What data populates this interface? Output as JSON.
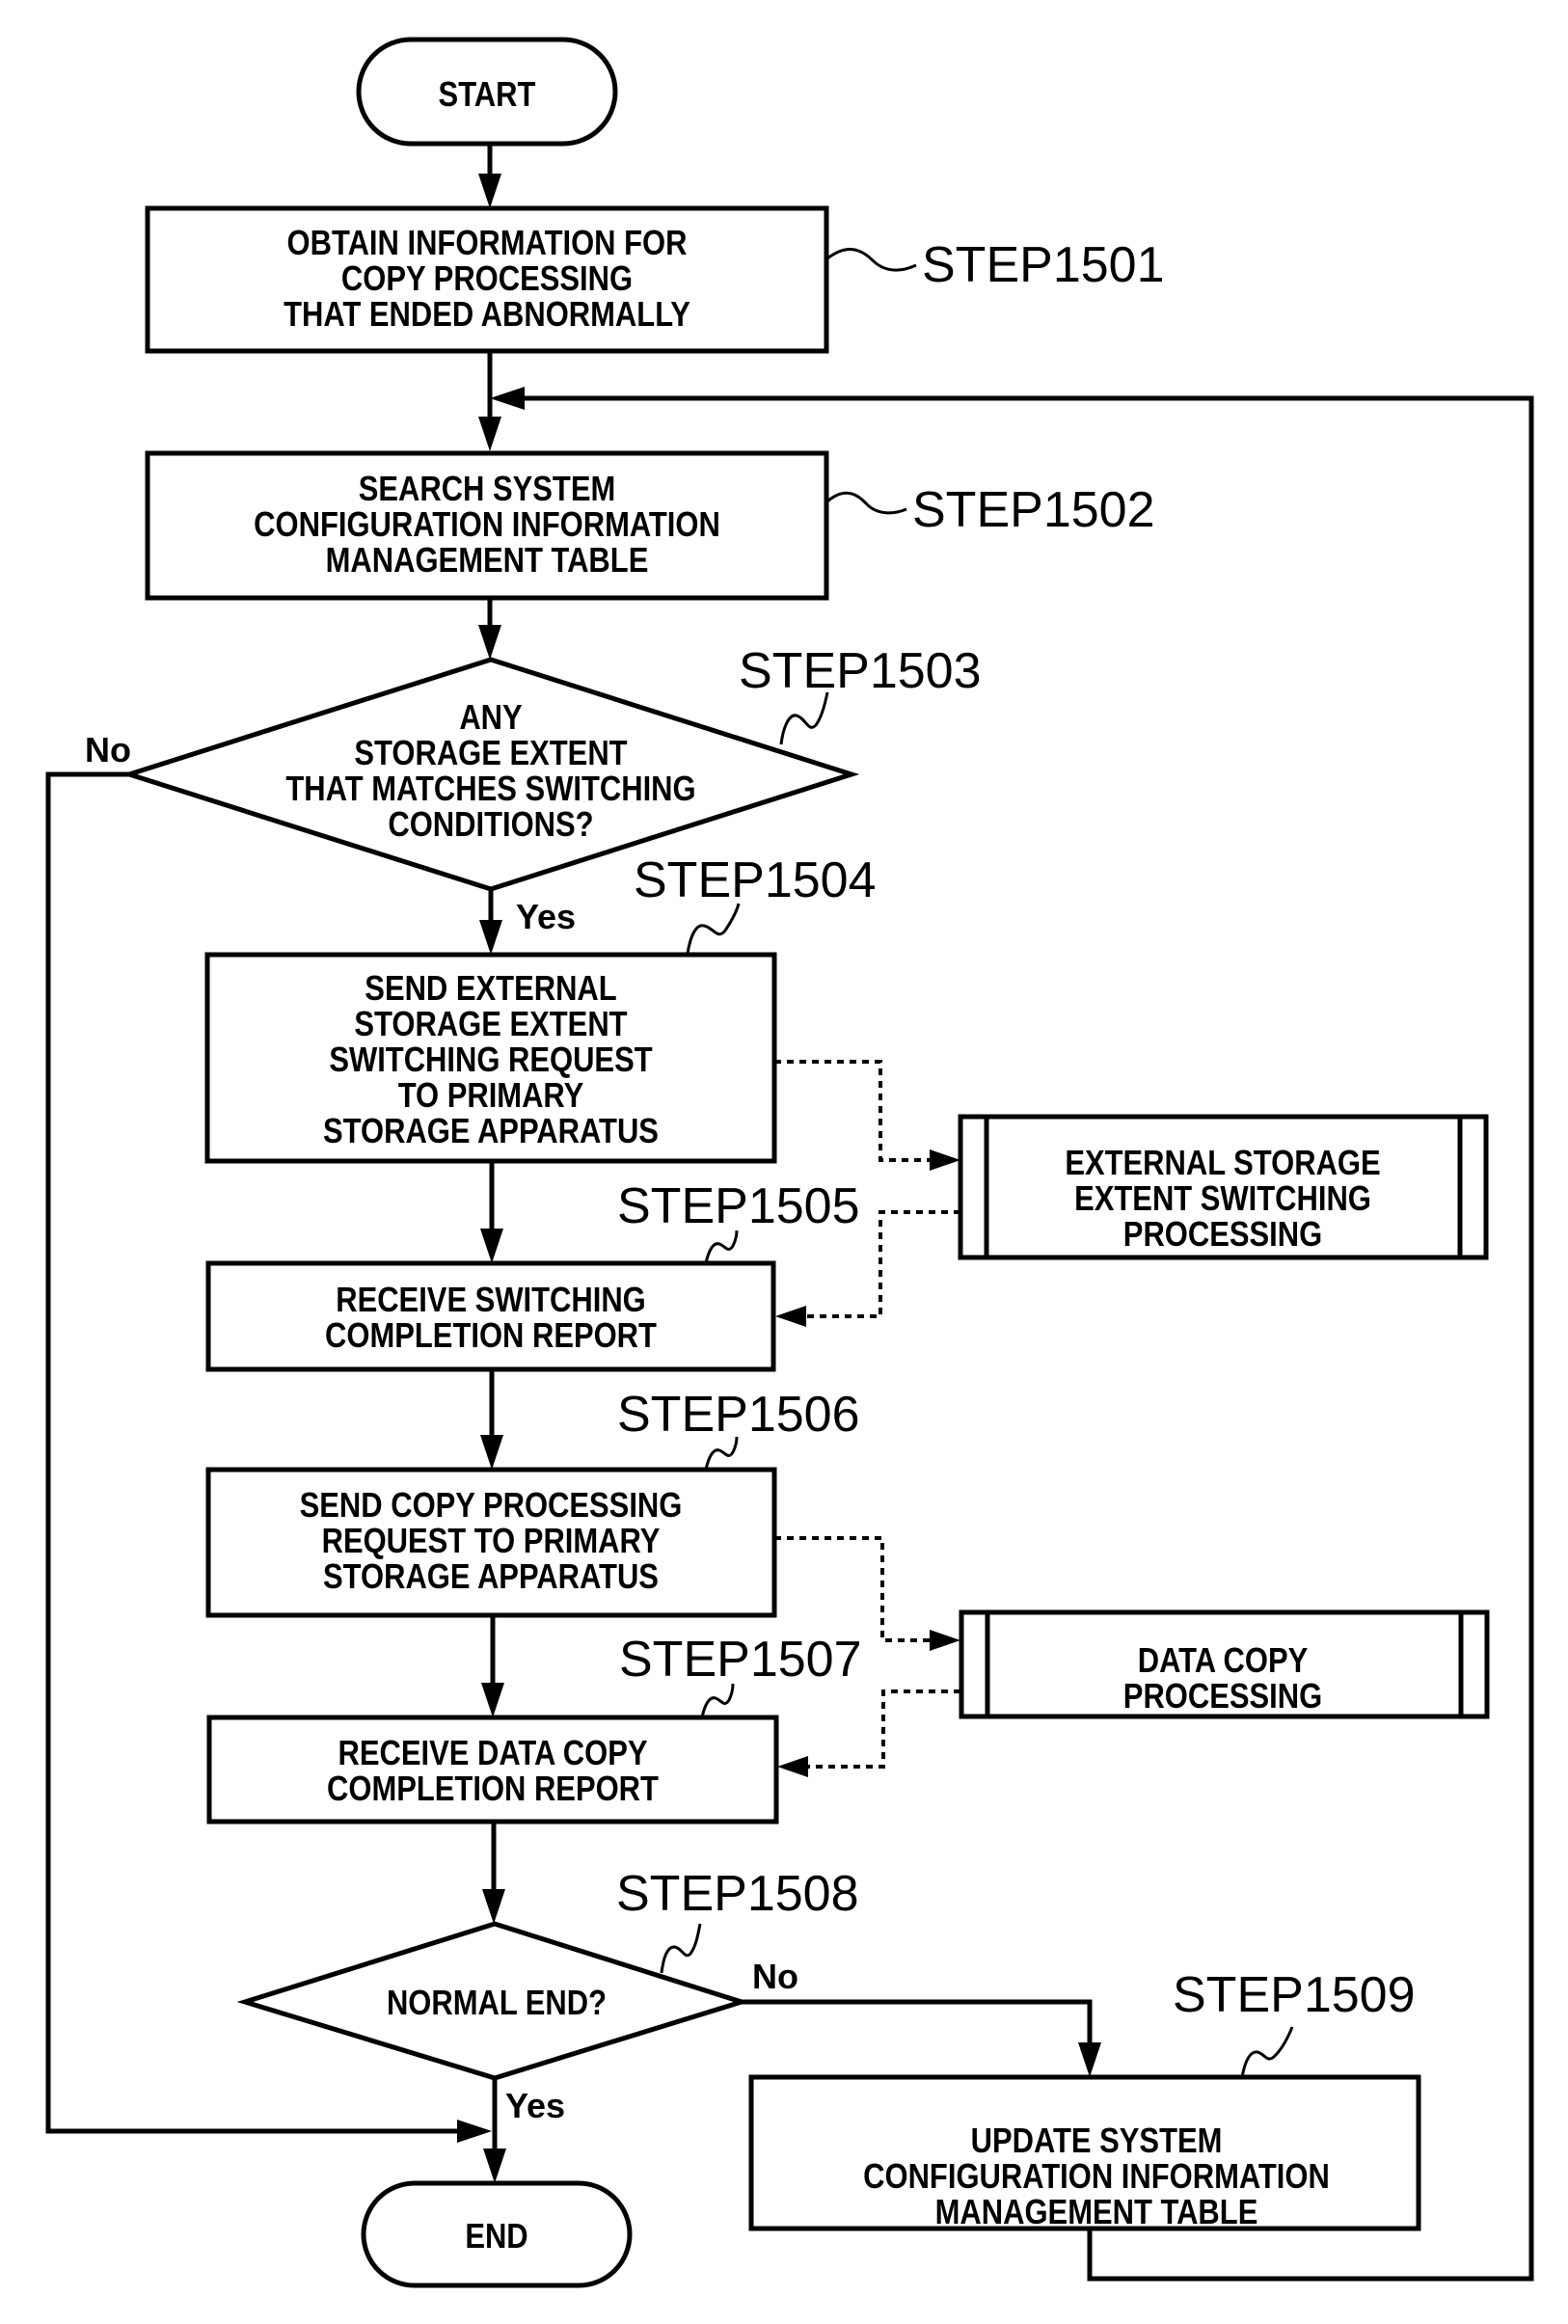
{
  "figure": {
    "terminals": {
      "start": "START",
      "end": "END"
    },
    "steps": {
      "s1501": {
        "label": "STEP1501",
        "lines": [
          "OBTAIN INFORMATION FOR",
          "COPY PROCESSING",
          "THAT ENDED ABNORMALLY"
        ]
      },
      "s1502": {
        "label": "STEP1502",
        "lines": [
          "SEARCH SYSTEM",
          "CONFIGURATION INFORMATION",
          "MANAGEMENT TABLE"
        ]
      },
      "s1503": {
        "label": "STEP1503",
        "lines": [
          "ANY",
          "STORAGE EXTENT",
          "THAT MATCHES SWITCHING",
          "CONDITIONS?"
        ]
      },
      "s1504": {
        "label": "STEP1504",
        "lines": [
          "SEND EXTERNAL",
          "STORAGE EXTENT",
          "SWITCHING REQUEST",
          "TO PRIMARY",
          "STORAGE APPARATUS"
        ]
      },
      "s1505": {
        "label": "STEP1505",
        "lines": [
          "RECEIVE SWITCHING",
          "COMPLETION REPORT"
        ]
      },
      "s1506": {
        "label": "STEP1506",
        "lines": [
          "SEND COPY PROCESSING",
          "REQUEST TO PRIMARY",
          "STORAGE APPARATUS"
        ]
      },
      "s1507": {
        "label": "STEP1507",
        "lines": [
          "RECEIVE DATA COPY",
          "COMPLETION REPORT"
        ]
      },
      "s1508": {
        "label": "STEP1508",
        "lines": [
          "NORMAL END?"
        ]
      },
      "s1509": {
        "label": "STEP1509",
        "lines": [
          "UPDATE SYSTEM",
          "CONFIGURATION INFORMATION",
          "MANAGEMENT TABLE"
        ]
      }
    },
    "subprocesses": {
      "switching": {
        "lines": [
          "EXTERNAL STORAGE",
          "EXTENT SWITCHING",
          "PROCESSING"
        ]
      },
      "data_copy": {
        "lines": [
          "DATA COPY",
          "PROCESSING"
        ]
      }
    },
    "branches": {
      "d1503_no": "No",
      "d1503_yes": "Yes",
      "d1508_no": "No",
      "d1508_yes": "Yes"
    }
  }
}
